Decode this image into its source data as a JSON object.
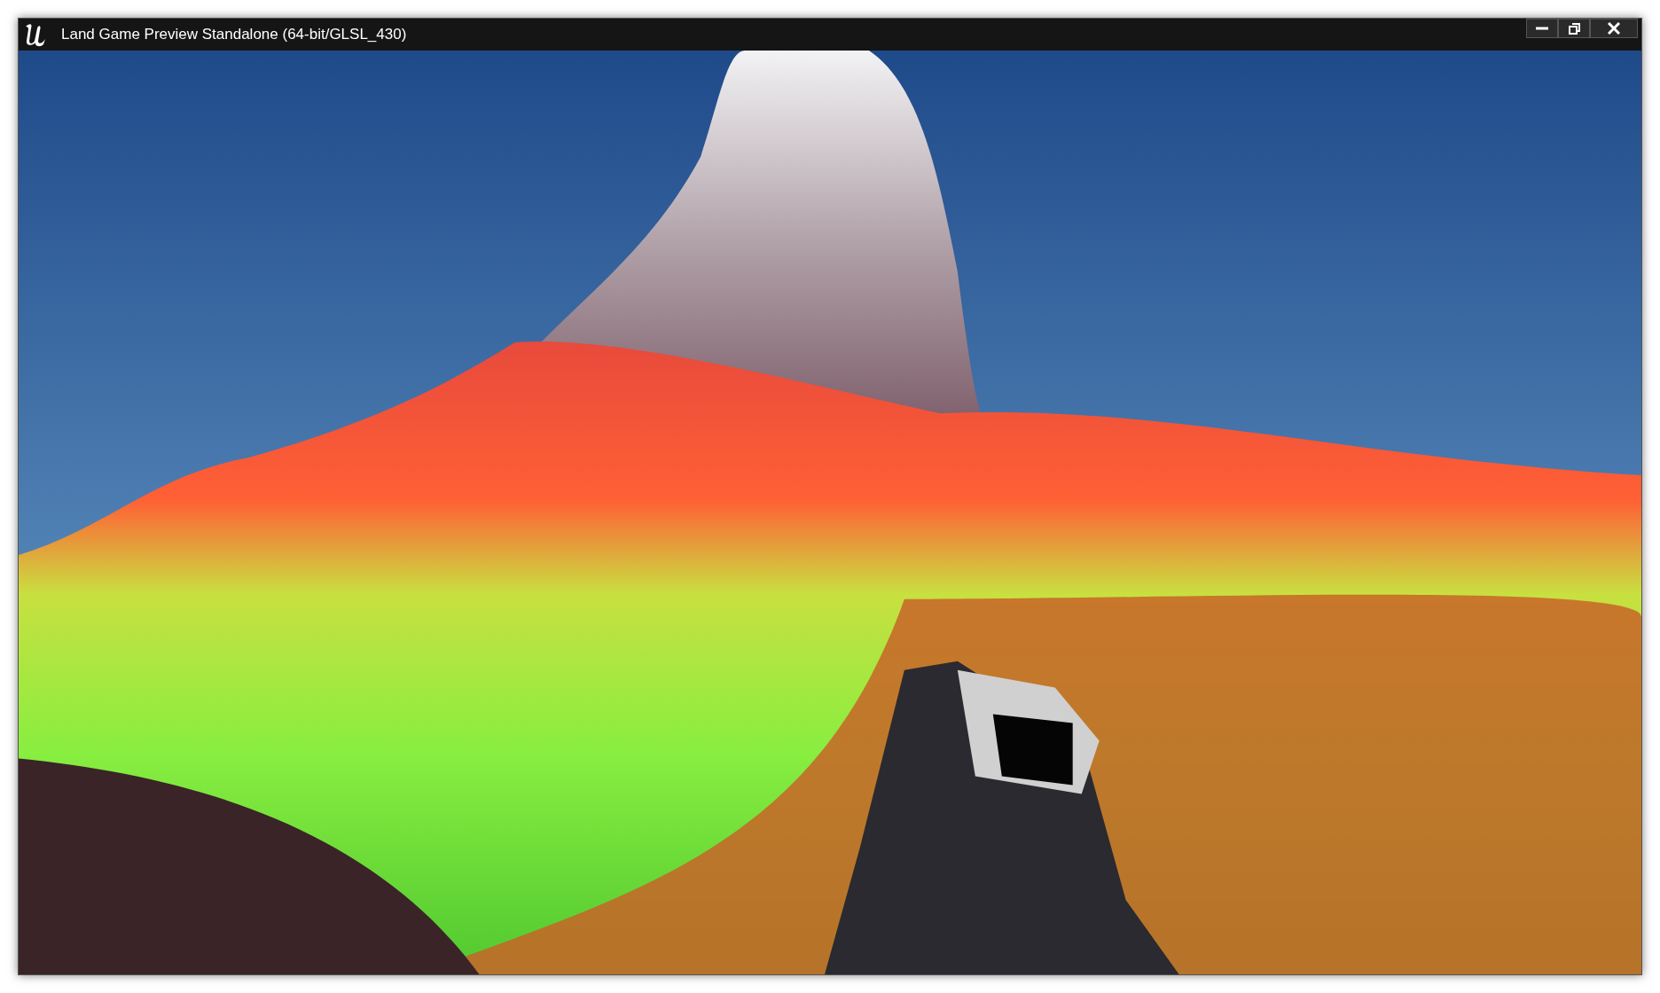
{
  "window": {
    "title": "Land Game Preview Standalone (64-bit/GLSL_430)"
  }
}
